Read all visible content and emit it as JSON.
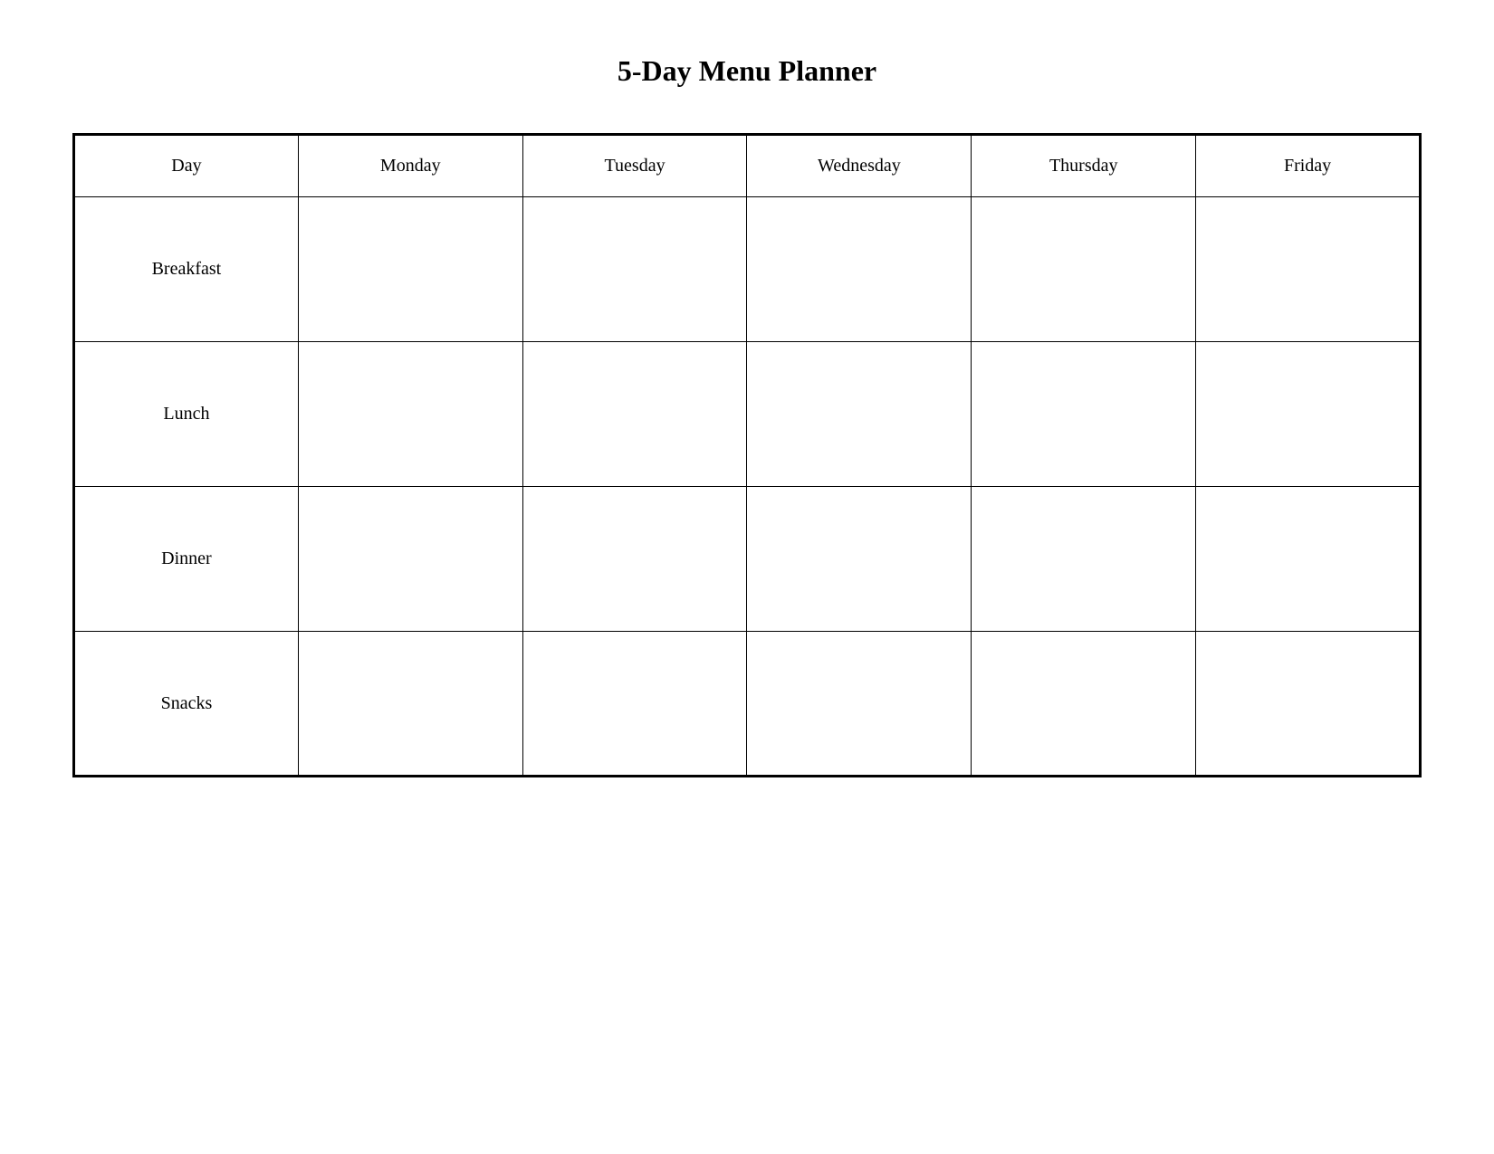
{
  "title": "5-Day Menu Planner",
  "table": {
    "columns": [
      {
        "label": "Day"
      },
      {
        "label": "Monday"
      },
      {
        "label": "Tuesday"
      },
      {
        "label": "Wednesday"
      },
      {
        "label": "Thursday"
      },
      {
        "label": "Friday"
      }
    ],
    "rows": [
      {
        "meal": "Breakfast"
      },
      {
        "meal": "Lunch"
      },
      {
        "meal": "Dinner"
      },
      {
        "meal": "Snacks"
      }
    ]
  }
}
